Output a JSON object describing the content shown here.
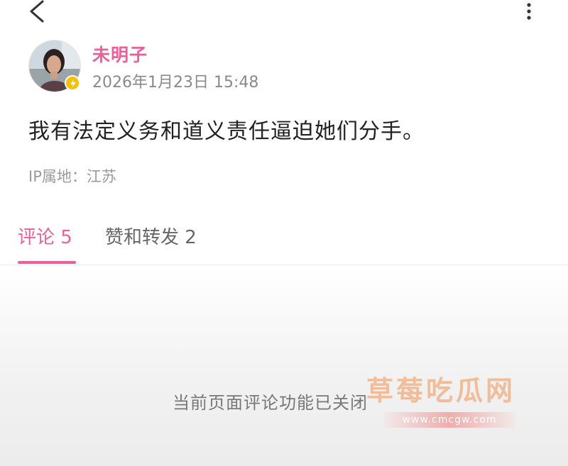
{
  "header": {
    "back_icon": "chevron-left-icon",
    "more_icon": "vertical-dots-icon"
  },
  "post": {
    "author": "未明子",
    "timestamp": "2026年1月23日 15:48",
    "text": "我有法定义务和道义责任逼迫她们分手。",
    "ip_location": "IP属地：江苏",
    "verified_badge_icon": "lightning-badge-icon"
  },
  "tabs": [
    {
      "label": "评论 5",
      "active": true
    },
    {
      "label": "赞和转发 2",
      "active": false
    }
  ],
  "comments": {
    "closed_message": "当前页面评论功能已关闭"
  },
  "watermark": {
    "title": "草莓吃瓜网",
    "url": "www.cmcgw.com"
  },
  "colors": {
    "accent": "#e9609a",
    "badge": "#f5c100",
    "muted_text": "#8a8a8a"
  }
}
